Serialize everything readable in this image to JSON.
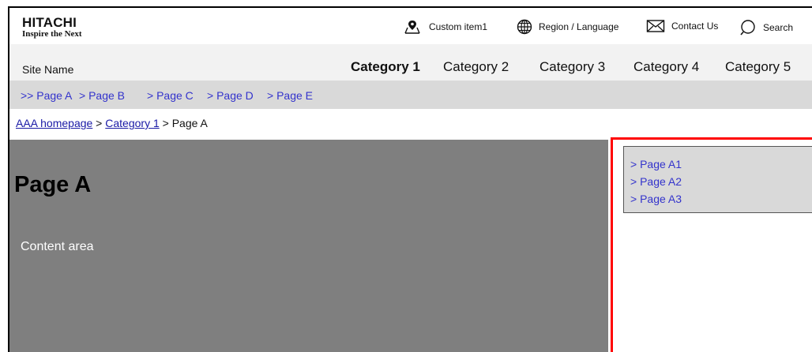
{
  "header": {
    "logo": {
      "brand": "HITACHI",
      "tagline": "Inspire the Next"
    },
    "utility": [
      {
        "label": "Custom item1",
        "icon": "map-pin-icon"
      },
      {
        "label": "Region / Language",
        "icon": "globe-icon"
      },
      {
        "label": "Contact Us",
        "icon": "mail-icon"
      },
      {
        "label": "Search",
        "icon": "search-icon"
      }
    ]
  },
  "nav": {
    "site_name": "Site Name",
    "categories": [
      "Category 1",
      "Category 2",
      "Category 3",
      "Category 4",
      "Category 5"
    ],
    "active_category": "Category 1"
  },
  "subnav": {
    "items": [
      ">> Page A",
      "> Page B",
      "> Page C",
      "> Page D",
      "> Page E"
    ]
  },
  "breadcrumb": {
    "home": "AAA homepage",
    "sep1": " > ",
    "category": "Category 1",
    "sep2": " > ",
    "current": "Page A"
  },
  "main": {
    "title": "Page A",
    "content_label": "Content area"
  },
  "sidebar": {
    "items": [
      "> Page A1",
      "> Page A2",
      "> Page A3"
    ]
  },
  "colors": {
    "link": "#3333cc",
    "highlight_border": "#ff0000",
    "content_bg": "#7f7f7f",
    "subnav_bg": "#d9d9d9"
  }
}
